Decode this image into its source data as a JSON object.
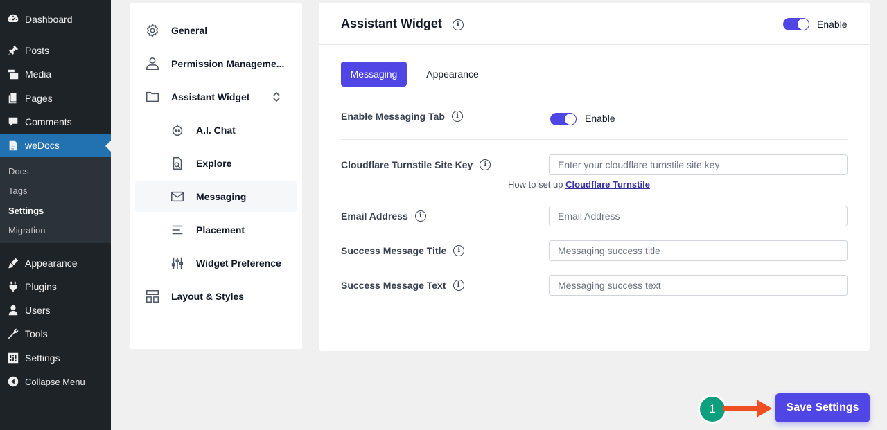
{
  "wp_menu": {
    "items": [
      {
        "label": "Dashboard",
        "icon": "dashboard-icon"
      },
      {
        "label": "Posts",
        "icon": "pin-icon"
      },
      {
        "label": "Media",
        "icon": "media-icon"
      },
      {
        "label": "Pages",
        "icon": "pages-icon"
      },
      {
        "label": "Comments",
        "icon": "comment-icon"
      },
      {
        "label": "weDocs",
        "icon": "document-icon"
      },
      {
        "label": "Appearance",
        "icon": "brush-icon"
      },
      {
        "label": "Plugins",
        "icon": "plugin-icon"
      },
      {
        "label": "Users",
        "icon": "user-icon"
      },
      {
        "label": "Tools",
        "icon": "wrench-icon"
      },
      {
        "label": "Settings",
        "icon": "sliders-icon"
      },
      {
        "label": "Collapse Menu",
        "icon": "collapse-icon"
      }
    ],
    "submenu": [
      "Docs",
      "Tags",
      "Settings",
      "Migration"
    ]
  },
  "settings_nav": {
    "items": [
      {
        "label": "General",
        "icon": "gear-icon"
      },
      {
        "label": "Permission Manageme...",
        "icon": "users-icon"
      },
      {
        "label": "Assistant Widget",
        "icon": "folder-icon"
      },
      {
        "label": "A.I. Chat",
        "icon": "bot-icon"
      },
      {
        "label": "Explore",
        "icon": "search-doc-icon"
      },
      {
        "label": "Messaging",
        "icon": "mail-icon"
      },
      {
        "label": "Placement",
        "icon": "align-left-icon"
      },
      {
        "label": "Widget Preference",
        "icon": "sliders-icon"
      },
      {
        "label": "Layout & Styles",
        "icon": "layout-icon"
      }
    ]
  },
  "panel": {
    "title": "Assistant Widget",
    "enable_label": "Enable",
    "tabs": [
      "Messaging",
      "Appearance"
    ],
    "enable_messaging_label": "Enable Messaging Tab",
    "enable_messaging_value": "Enable",
    "turnstile_label": "Cloudflare Turnstile Site Key",
    "turnstile_placeholder": "Enter your cloudflare turnstile site key",
    "help_prefix": "How to set up",
    "help_link": "Cloudflare Turnstile",
    "email_label": "Email Address",
    "email_placeholder": "Email Address",
    "success_title_label": "Success Message Title",
    "success_title_placeholder": "Messaging success title",
    "success_text_label": "Success Message Text",
    "success_text_placeholder": "Messaging success text"
  },
  "save": {
    "label": "Save Settings",
    "step": "1"
  },
  "colors": {
    "accent": "#4f46e5",
    "wp_sidebar": "#1d2327",
    "wp_current": "#2271b1",
    "annotation_arrow": "#f04e23",
    "step_badge": "#0e9f7e"
  }
}
